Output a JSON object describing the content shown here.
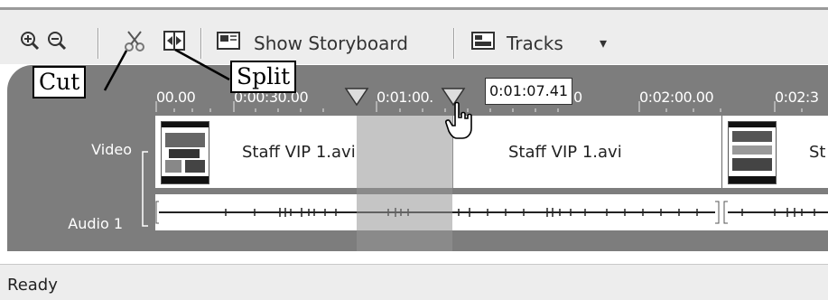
{
  "toolbar": {
    "zoom_in_icon": "zoom-in-icon",
    "zoom_out_icon": "zoom-out-icon",
    "cut_icon": "scissors-icon",
    "split_icon": "split-icon",
    "storyboard_label": "Show Storyboard",
    "tracks_label": "Tracks",
    "tracks_dropdown": "▾"
  },
  "callouts": {
    "cut": "Cut",
    "split": "Split"
  },
  "ruler": {
    "ticks": [
      "00.00",
      "0:00:30.00",
      "0:01:00.",
      "0",
      "0:02:00.00",
      "0:02:3"
    ],
    "current_time": "0:01:07.41"
  },
  "tracks": {
    "video_label": "Video",
    "audio_label": "Audio 1",
    "clips": [
      "Staff VIP 1.avi",
      "Staff VIP 1.avi",
      "St"
    ]
  },
  "status": {
    "text": "Ready"
  },
  "colors": {
    "panel": "#7d7d7d",
    "toolbar": "#ededed",
    "selection": "#a8a8a8"
  }
}
